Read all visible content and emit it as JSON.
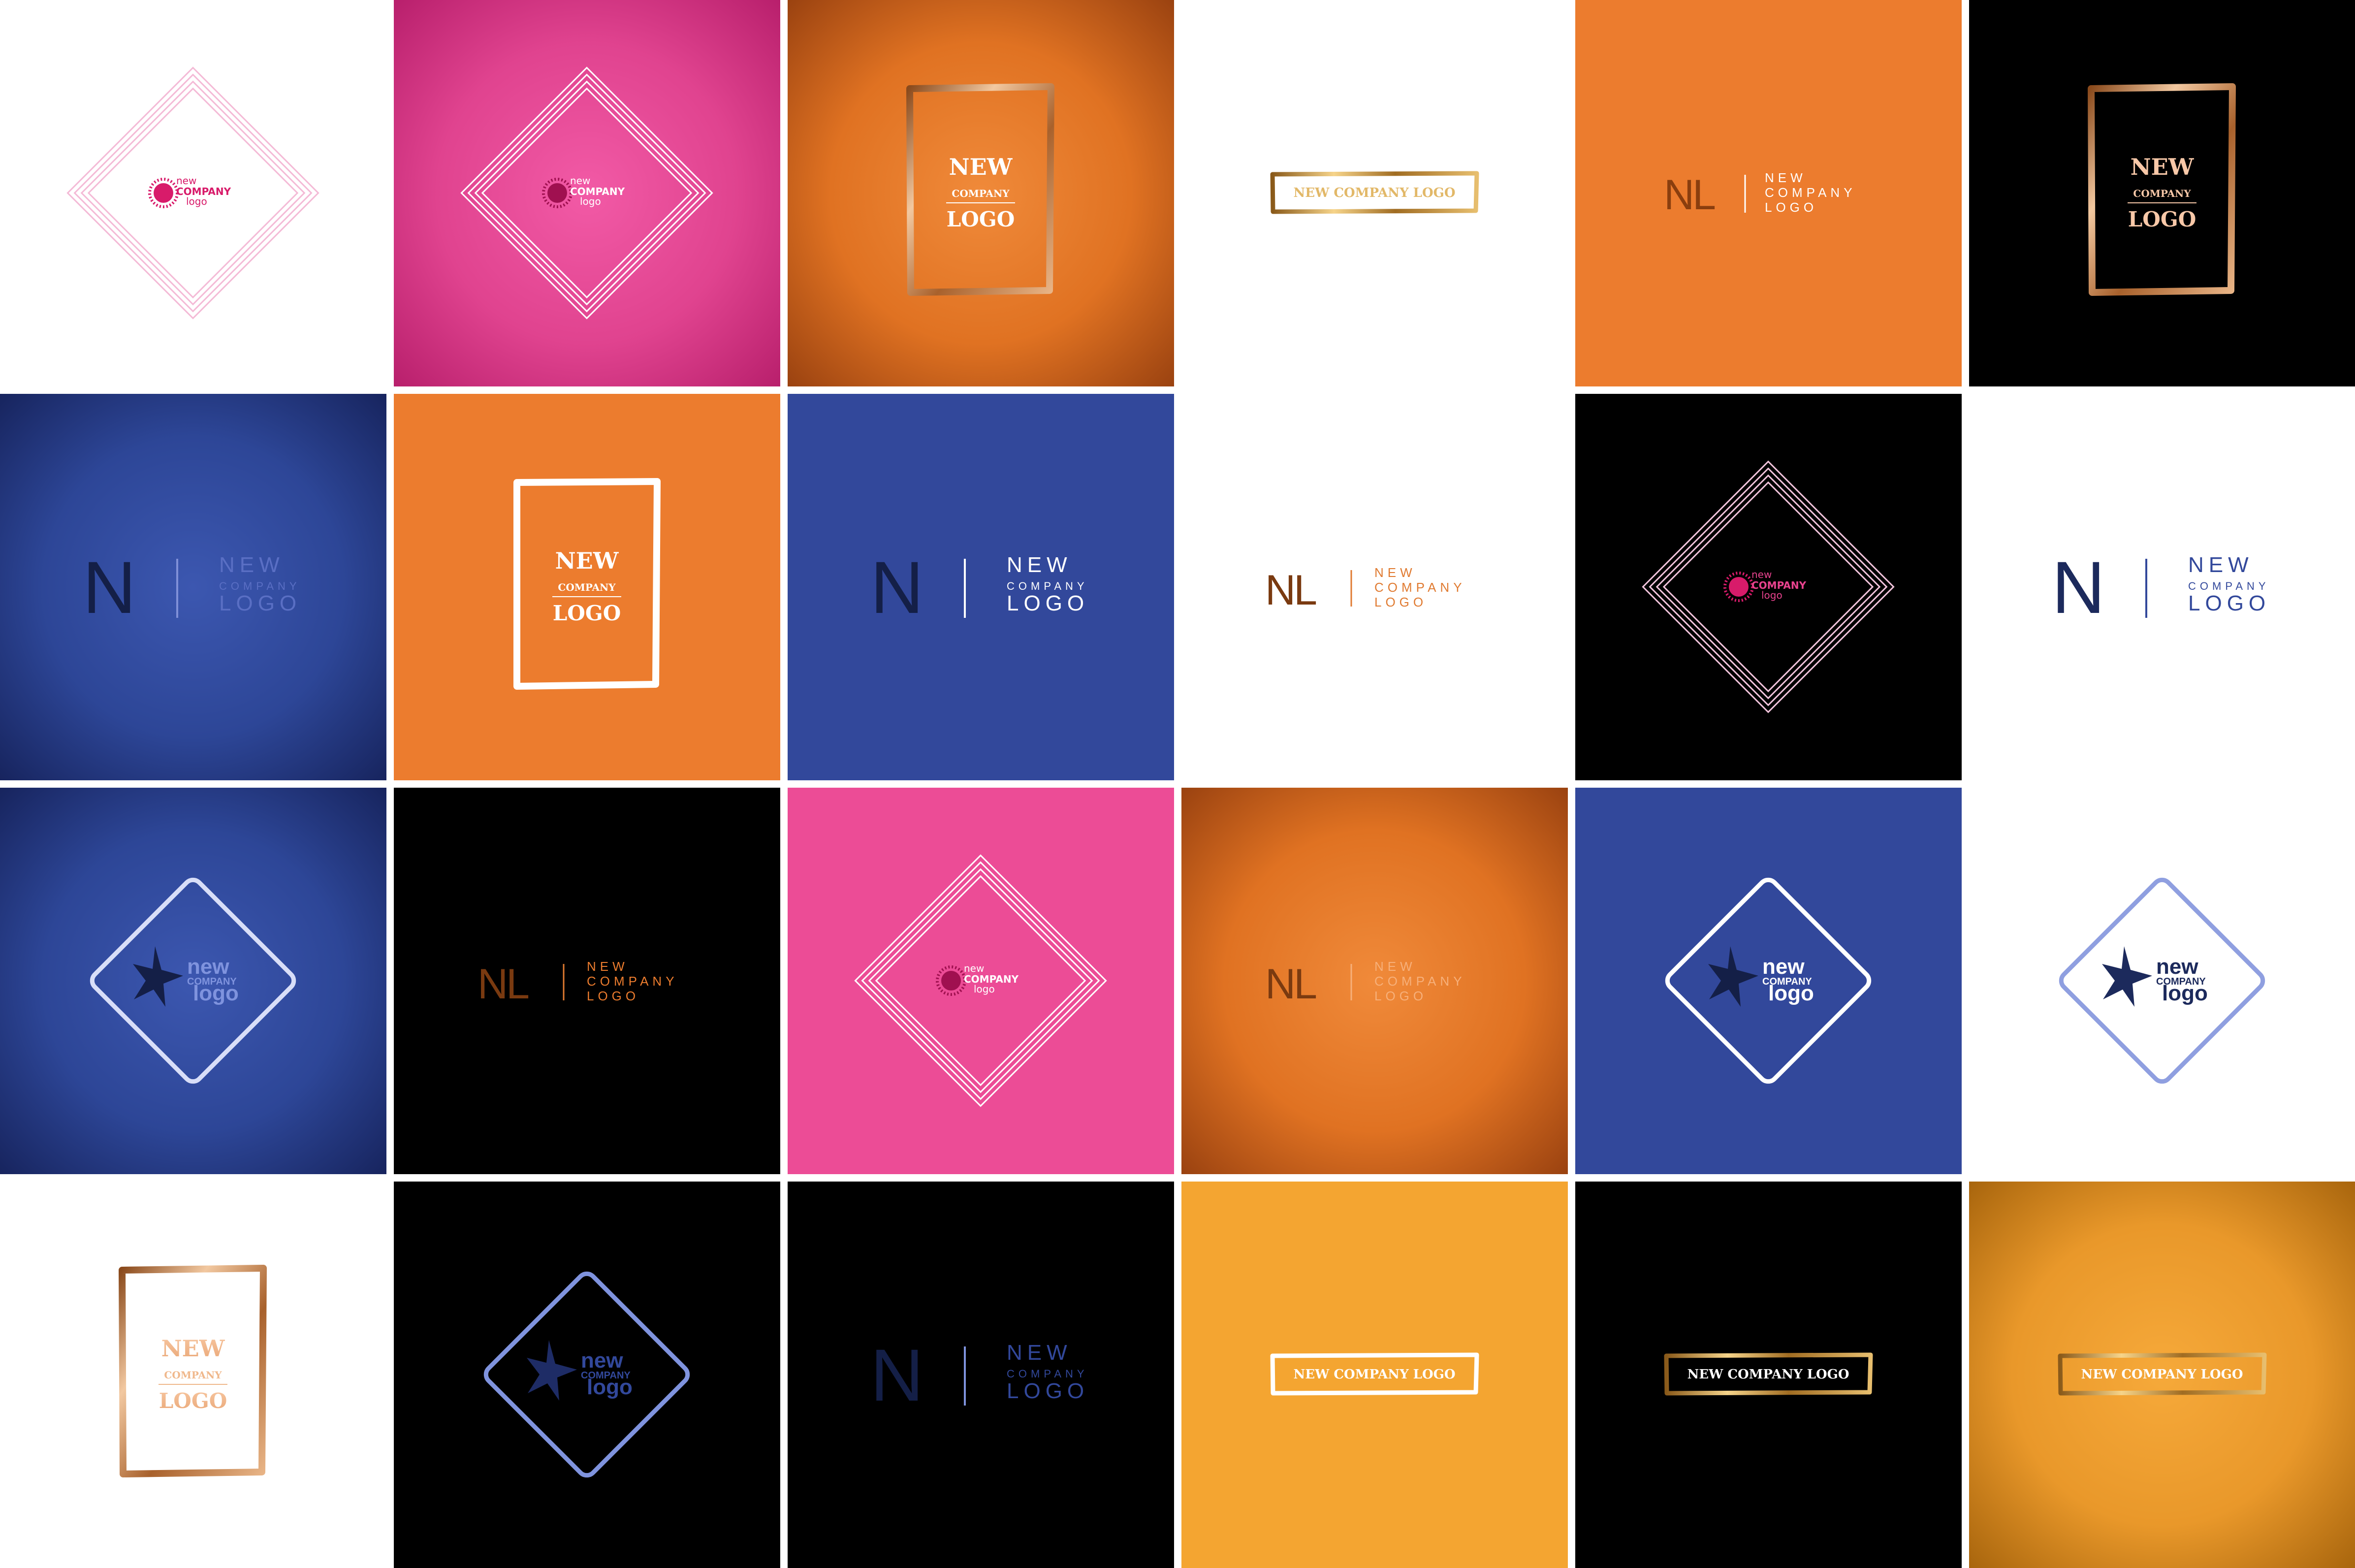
{
  "colors": {
    "white": "#ffffff",
    "black": "#000000",
    "orange": "#ec7c2e",
    "blue": "#32489b",
    "navy": "#1c2a5c",
    "pink": "#ec4c96",
    "gold": "#f4a531",
    "light_pink": "#f4bad6",
    "periwinkle": "#7f93de",
    "copper": "#c98754",
    "brown": "#7a3a10"
  },
  "logos": {
    "burst": {
      "word1": "new",
      "word2": "COMPANY",
      "word3": "logo"
    },
    "frame": {
      "word1": "NEW",
      "word2": "COMPANY",
      "word3": "LOGO"
    },
    "banner": {
      "text": "NEW COMPANY LOGO"
    },
    "nl": {
      "mark": "NL",
      "word1": "NEW",
      "word2": "COMPANY",
      "word3": "LOGO"
    },
    "n": {
      "mark": "N",
      "word1": "NEW",
      "word2": "COMPANY",
      "word3": "LOGO"
    },
    "star": {
      "word1": "new",
      "word2": "COMPANY",
      "word3": "logo"
    }
  },
  "tiles": [
    {
      "row": 1,
      "col": 1,
      "logo": "burst",
      "background": "white"
    },
    {
      "row": 1,
      "col": 2,
      "logo": "burst",
      "background": "pink"
    },
    {
      "row": 1,
      "col": 3,
      "logo": "frame",
      "background": "orange"
    },
    {
      "row": 1,
      "col": 4,
      "logo": "banner",
      "background": "white"
    },
    {
      "row": 1,
      "col": 5,
      "logo": "nl",
      "background": "orange"
    },
    {
      "row": 1,
      "col": 6,
      "logo": "frame",
      "background": "black"
    },
    {
      "row": 2,
      "col": 1,
      "logo": "n",
      "background": "blue"
    },
    {
      "row": 2,
      "col": 2,
      "logo": "frame",
      "background": "orange"
    },
    {
      "row": 2,
      "col": 3,
      "logo": "n",
      "background": "blue"
    },
    {
      "row": 2,
      "col": 4,
      "logo": "nl",
      "background": "white"
    },
    {
      "row": 2,
      "col": 5,
      "logo": "burst",
      "background": "black"
    },
    {
      "row": 2,
      "col": 6,
      "logo": "n",
      "background": "white"
    },
    {
      "row": 3,
      "col": 1,
      "logo": "star",
      "background": "blue"
    },
    {
      "row": 3,
      "col": 2,
      "logo": "nl",
      "background": "black"
    },
    {
      "row": 3,
      "col": 3,
      "logo": "burst",
      "background": "pink"
    },
    {
      "row": 3,
      "col": 4,
      "logo": "nl",
      "background": "orange"
    },
    {
      "row": 3,
      "col": 5,
      "logo": "star",
      "background": "blue"
    },
    {
      "row": 3,
      "col": 6,
      "logo": "star",
      "background": "white"
    },
    {
      "row": 4,
      "col": 1,
      "logo": "frame",
      "background": "white"
    },
    {
      "row": 4,
      "col": 2,
      "logo": "star",
      "background": "black"
    },
    {
      "row": 4,
      "col": 3,
      "logo": "n",
      "background": "black"
    },
    {
      "row": 4,
      "col": 4,
      "logo": "banner",
      "background": "gold"
    },
    {
      "row": 4,
      "col": 5,
      "logo": "banner",
      "background": "black"
    },
    {
      "row": 4,
      "col": 6,
      "logo": "banner",
      "background": "gold"
    }
  ]
}
